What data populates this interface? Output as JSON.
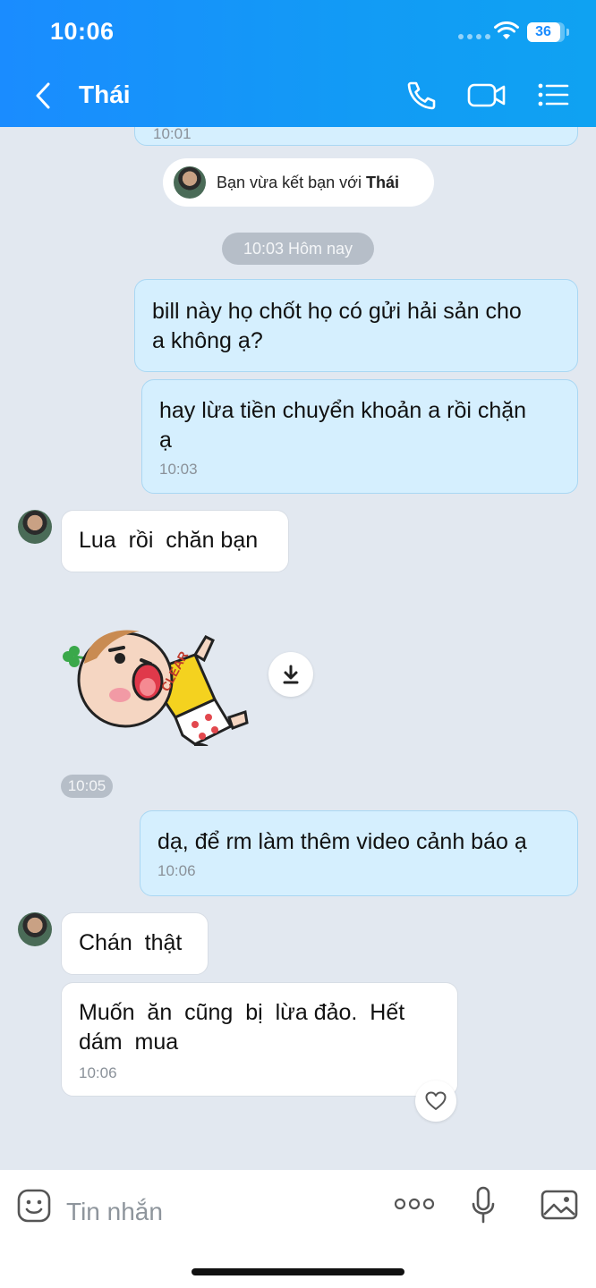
{
  "status_bar": {
    "time": "10:06",
    "battery": "36",
    "battery_level_pct": 36
  },
  "header": {
    "contact_name": "Thái",
    "icons": [
      "back-icon",
      "phone-icon",
      "video-icon",
      "menu-icon"
    ]
  },
  "chat": {
    "partial_time": "10:01",
    "friend_notice": {
      "prefix": "Bạn vừa kết bạn với ",
      "name": "Thái"
    },
    "date_pill": "10:03 Hôm nay",
    "messages": [
      {
        "dir": "out",
        "text": "bill này họ chốt họ có gửi hải sản cho\na không ạ?"
      },
      {
        "dir": "out",
        "text": "hay lừa tiền chuyển khoản a rồi chặn\nạ",
        "time": "10:03"
      },
      {
        "dir": "in",
        "text": "Lua  rồi  chăn bạn"
      },
      {
        "dir": "in",
        "type": "sticker",
        "sticker_label": "CLEAR",
        "time": "10:05"
      },
      {
        "dir": "out",
        "text": "dạ, để rm làm thêm video cảnh báo ạ",
        "time": "10:06"
      },
      {
        "dir": "in",
        "text": "Chán  thật"
      },
      {
        "dir": "in",
        "text": "Muốn  ăn  cũng  bị  lừa đảo.  Hết\ndám  mua",
        "time": "10:06"
      }
    ]
  },
  "input_bar": {
    "placeholder": "Tin nhắn",
    "icons": [
      "emoji-icon",
      "more-icon",
      "mic-icon",
      "image-icon"
    ]
  },
  "colors": {
    "header": "#1a8cff",
    "chat_bg": "#e2e8f0",
    "outgoing_bubble": "#d5effe",
    "incoming_bubble": "#ffffff"
  }
}
